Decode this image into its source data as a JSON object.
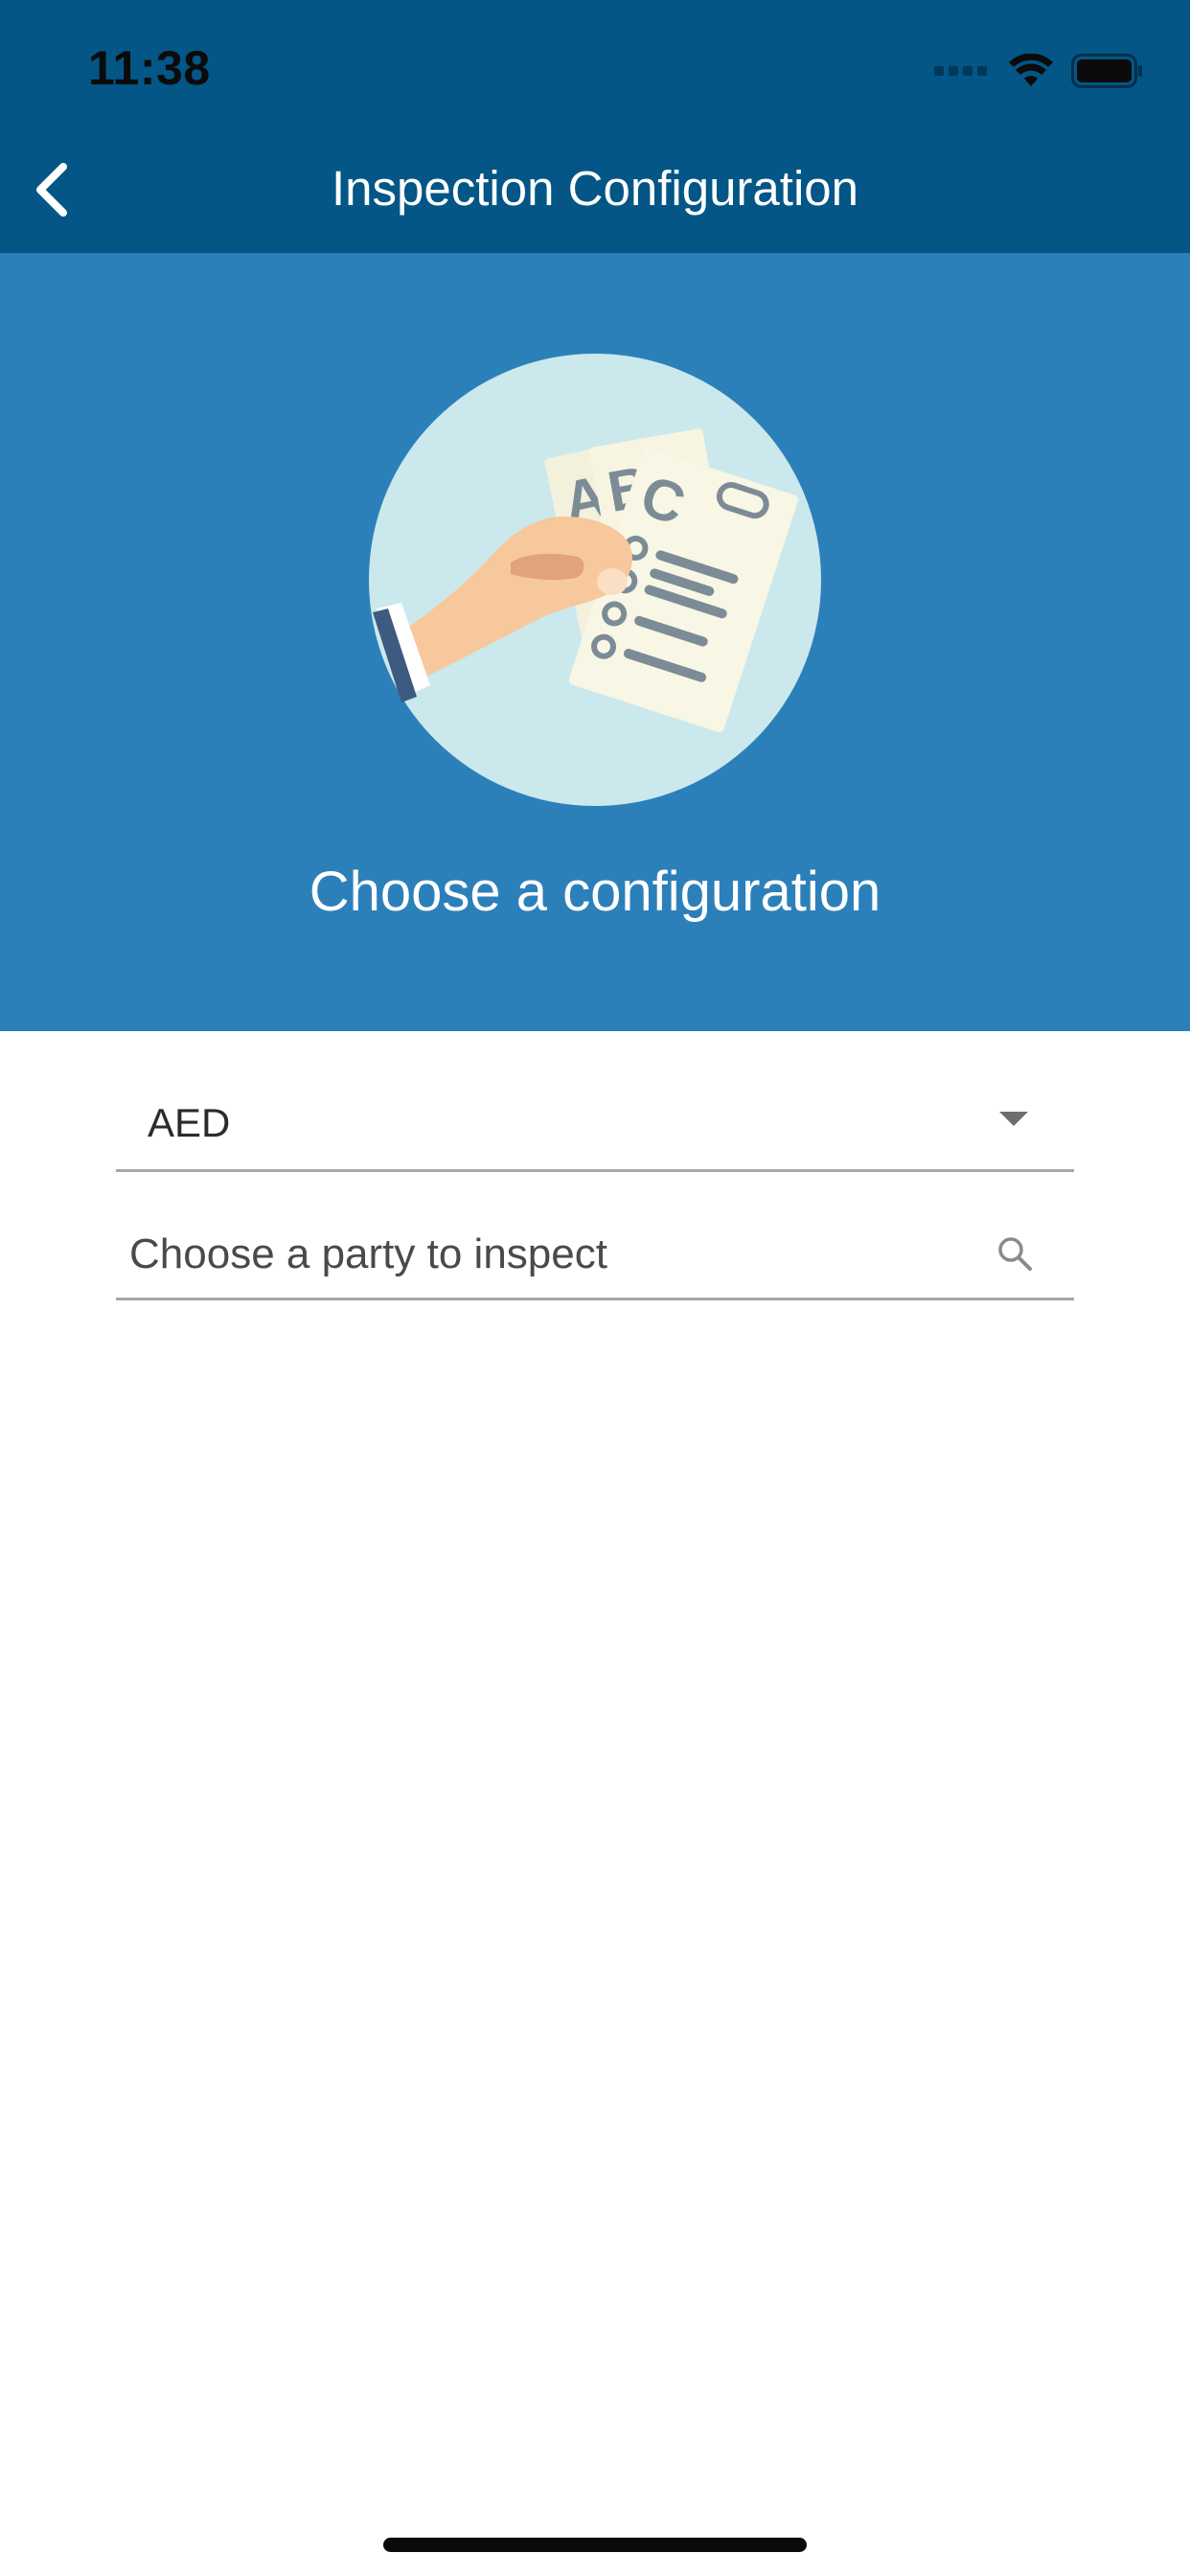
{
  "status_bar": {
    "time": "11:38",
    "icons": [
      "cellular-signal-icon",
      "wifi-icon",
      "battery-icon"
    ]
  },
  "nav": {
    "title": "Inspection Configuration",
    "back_icon": "chevron-left-icon"
  },
  "hero": {
    "illustration": "hand-holding-documents-illustration",
    "heading": "Choose a configuration"
  },
  "form": {
    "configuration_select": {
      "selected_value": "AED",
      "icon": "dropdown-arrow-icon"
    },
    "party_search": {
      "value": "",
      "placeholder": "Choose a party to inspect",
      "icon": "search-icon"
    }
  },
  "colors": {
    "nav_background": "#035685",
    "hero_background": "#2c80ba",
    "illustration_circle": "#cbe8ec",
    "field_underline": "#a8a8a8"
  }
}
